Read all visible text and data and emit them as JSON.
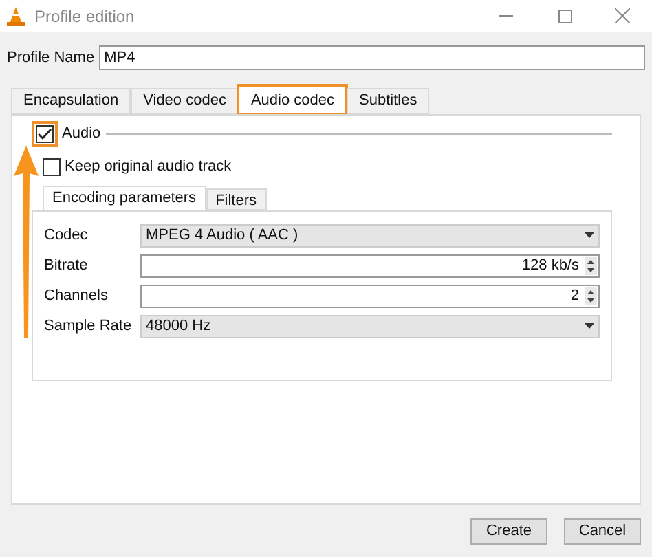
{
  "window": {
    "title": "Profile edition"
  },
  "profile_name": {
    "label": "Profile Name",
    "value": "MP4"
  },
  "tabs": [
    {
      "label": "Encapsulation",
      "selected": false,
      "highlighted": false
    },
    {
      "label": "Video codec",
      "selected": false,
      "highlighted": false
    },
    {
      "label": "Audio codec",
      "selected": true,
      "highlighted": true
    },
    {
      "label": "Subtitles",
      "selected": false,
      "highlighted": false
    }
  ],
  "audio": {
    "label": "Audio",
    "checked": true,
    "highlighted": true
  },
  "keep_original": {
    "label": "Keep original audio track",
    "checked": false
  },
  "inner_tabs": [
    {
      "label": "Encoding parameters",
      "selected": true
    },
    {
      "label": "Filters",
      "selected": false
    }
  ],
  "fields": [
    {
      "kind": "dropdown",
      "label": "Codec",
      "value": "MPEG 4 Audio ( AAC )"
    },
    {
      "kind": "spinbox",
      "label": "Bitrate",
      "value": "128 kb/s"
    },
    {
      "kind": "spinbox",
      "label": "Channels",
      "value": "2"
    },
    {
      "kind": "dropdown",
      "label": "Sample Rate",
      "value": "48000 Hz"
    }
  ],
  "buttons": [
    "Create",
    "Cancel"
  ]
}
